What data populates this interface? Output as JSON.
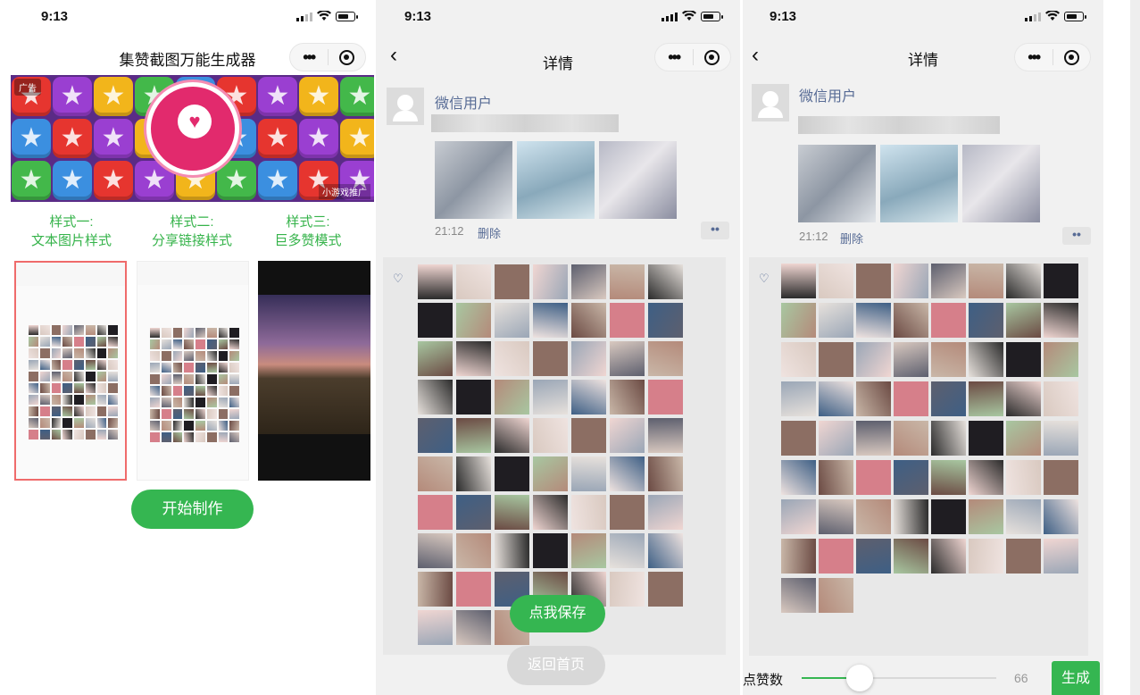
{
  "status": {
    "screen1_time": "9:13",
    "screen2_time": "9:13",
    "screen3_time": "9:13"
  },
  "screen1": {
    "title": "集赞截图万能生成器",
    "ad": {
      "badge": "广告",
      "source": "小游戏推广"
    },
    "styles": [
      {
        "line1": "样式一:",
        "line2": "文本图片样式"
      },
      {
        "line1": "样式二:",
        "line2": "分享链接样式"
      },
      {
        "line1": "样式三:",
        "line2": "巨多赞模式"
      }
    ],
    "start_button": "开始制作"
  },
  "screen2": {
    "title": "详情",
    "nickname": "微信用户",
    "time": "21:12",
    "delete": "删除",
    "save_button": "点我保存",
    "home_button": "返回首页"
  },
  "screen3": {
    "title": "详情",
    "nickname": "微信用户",
    "time": "21:12",
    "delete": "删除",
    "likes_label": "点赞数",
    "likes_value": "66",
    "likes_fraction": 0.3,
    "generate_button": "生成"
  },
  "colors": {
    "accent_green": "#35b651",
    "link_blue": "#576b95",
    "style_label_green": "#35b34a",
    "selected_border": "#ef6b6b"
  },
  "icons": {
    "back": "chevron-left-icon",
    "menu": "more-dots-icon",
    "close": "record-circle-icon",
    "like": "heart-icon",
    "avatar": "default-user-icon"
  }
}
